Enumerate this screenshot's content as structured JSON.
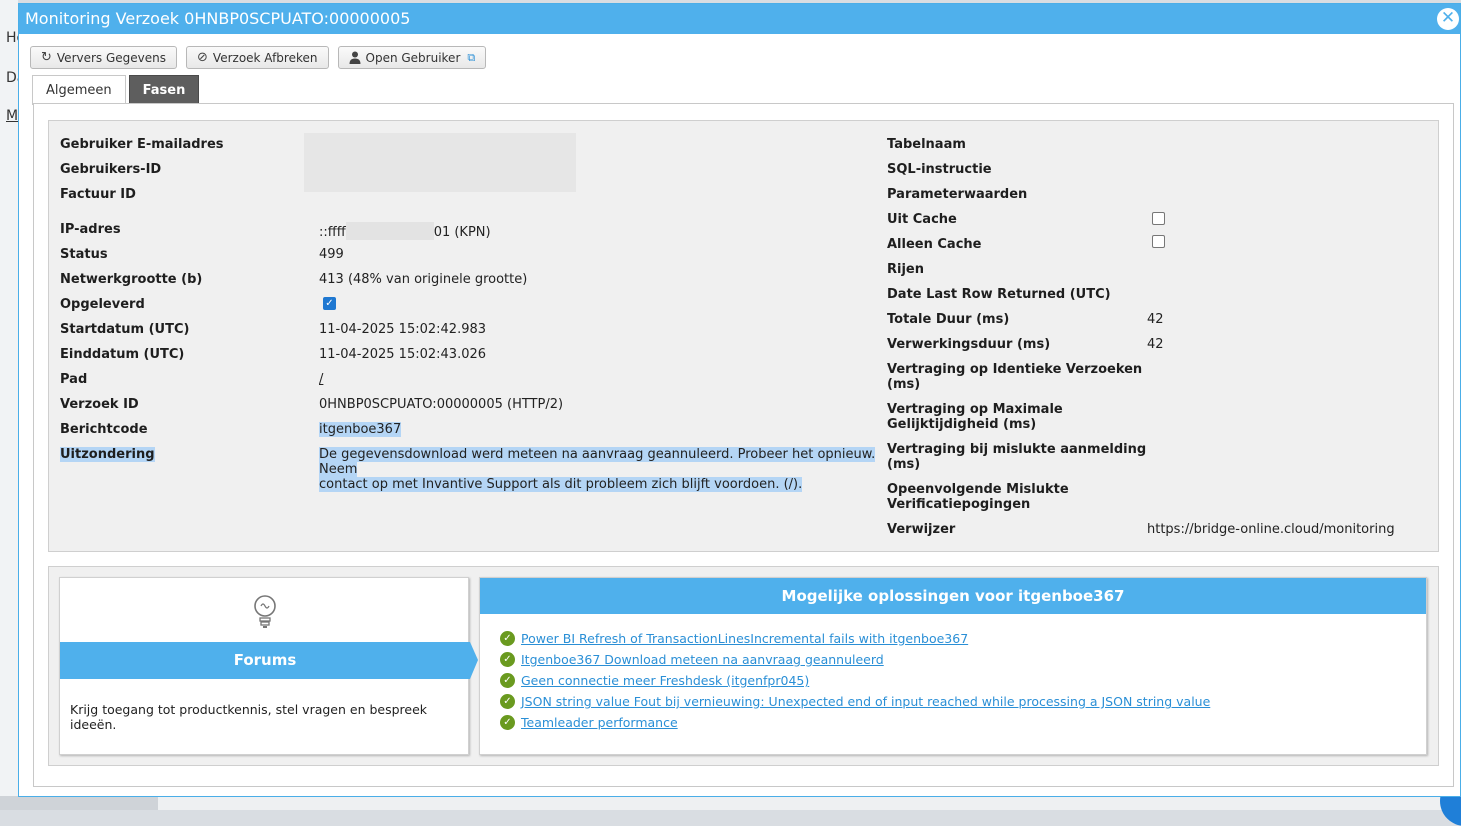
{
  "background": {
    "fragments": [
      "Ho",
      "Da",
      "M"
    ]
  },
  "window": {
    "title": "Monitoring Verzoek 0HNBP0SCPUATO:00000005",
    "close_icon": "close-icon"
  },
  "toolbar": {
    "refresh_label": "Ververs Gegevens",
    "abort_label": "Verzoek Afbreken",
    "open_user_label": "Open Gebruiker"
  },
  "tabs": [
    {
      "label": "Algemeen",
      "active": true
    },
    {
      "label": "Fasen",
      "active": false
    }
  ],
  "left_fields": {
    "email": {
      "label": "Gebruiker E-mailadres"
    },
    "user_id": {
      "label": "Gebruikers-ID"
    },
    "invoice_id": {
      "label": "Factuur ID"
    },
    "ip": {
      "label": "IP-adres",
      "prefix": "::ffff",
      "suffix": "01 (KPN)"
    },
    "status": {
      "label": "Status",
      "value": "499"
    },
    "network_size": {
      "label": "Netwerkgrootte (b)",
      "value": "413 (48% van originele grootte)"
    },
    "delivered": {
      "label": "Opgeleverd",
      "checked": true
    },
    "start_date": {
      "label": "Startdatum (UTC)",
      "value": "11-04-2025 15:02:42.983"
    },
    "end_date": {
      "label": "Einddatum (UTC)",
      "value": "11-04-2025 15:02:43.026"
    },
    "path": {
      "label": "Pad",
      "value": "/"
    },
    "request_id": {
      "label": "Verzoek ID",
      "value": "0HNBP0SCPUATO:00000005 (HTTP/2)"
    },
    "message_code": {
      "label": "Berichtcode",
      "value": "itgenboe367"
    },
    "exception": {
      "label": "Uitzondering",
      "line1": "De gegevensdownload werd meteen na aanvraag geannuleerd. Probeer het opnieuw. Neem",
      "line2": "contact op met Invantive Support als dit probleem zich blijft voordoen. (/)."
    }
  },
  "right_fields": {
    "table_name": {
      "label": "Tabelnaam"
    },
    "sql": {
      "label": "SQL-instructie"
    },
    "params": {
      "label": "Parameterwaarden"
    },
    "from_cache": {
      "label": "Uit Cache",
      "checked": false
    },
    "only_cache": {
      "label": "Alleen Cache",
      "checked": false
    },
    "rows": {
      "label": "Rijen"
    },
    "last_row": {
      "label": "Date Last Row Returned (UTC)"
    },
    "total_duration": {
      "label": "Totale Duur (ms)",
      "value": "42"
    },
    "processing_duration": {
      "label": "Verwerkingsduur (ms)",
      "value": "42"
    },
    "delay_identical": {
      "label_line1": "Vertraging op Identieke Verzoeken",
      "label_line2": "(ms)"
    },
    "delay_parallel": {
      "label_line1": "Vertraging op Maximale",
      "label_line2": "Gelijktijdigheid (ms)"
    },
    "delay_failed_login": {
      "label_line1": "Vertraging bij mislukte aanmelding",
      "label_line2": "(ms)"
    },
    "failed_attempts": {
      "label_line1": "Opeenvolgende Mislukte",
      "label_line2": "Verificatiepogingen"
    },
    "referrer": {
      "label": "Verwijzer",
      "value": "https://bridge-online.cloud/monitoring"
    }
  },
  "forums": {
    "icon": "lightbulb-icon",
    "title": "Forums",
    "description": "Krijg toegang tot productkennis, stel vragen en bespreek ideeën."
  },
  "solutions": {
    "title": "Mogelijke oplossingen voor itgenboe367",
    "items": [
      "Power BI Refresh of TransactionLinesIncremental fails with itgenboe367",
      "Itgenboe367 Download meteen na aanvraag geannuleerd",
      "Geen connectie meer Freshdesk (itgenfpr045)",
      "JSON string value Fout bij vernieuwing: Unexpected end of input reached while processing a JSON string value",
      "Teamleader performance"
    ]
  },
  "colors": {
    "accent": "#4fb0ec",
    "link": "#2a8fd6",
    "check_green": "#6a9a1f",
    "highlight": "#b4d5f5"
  }
}
